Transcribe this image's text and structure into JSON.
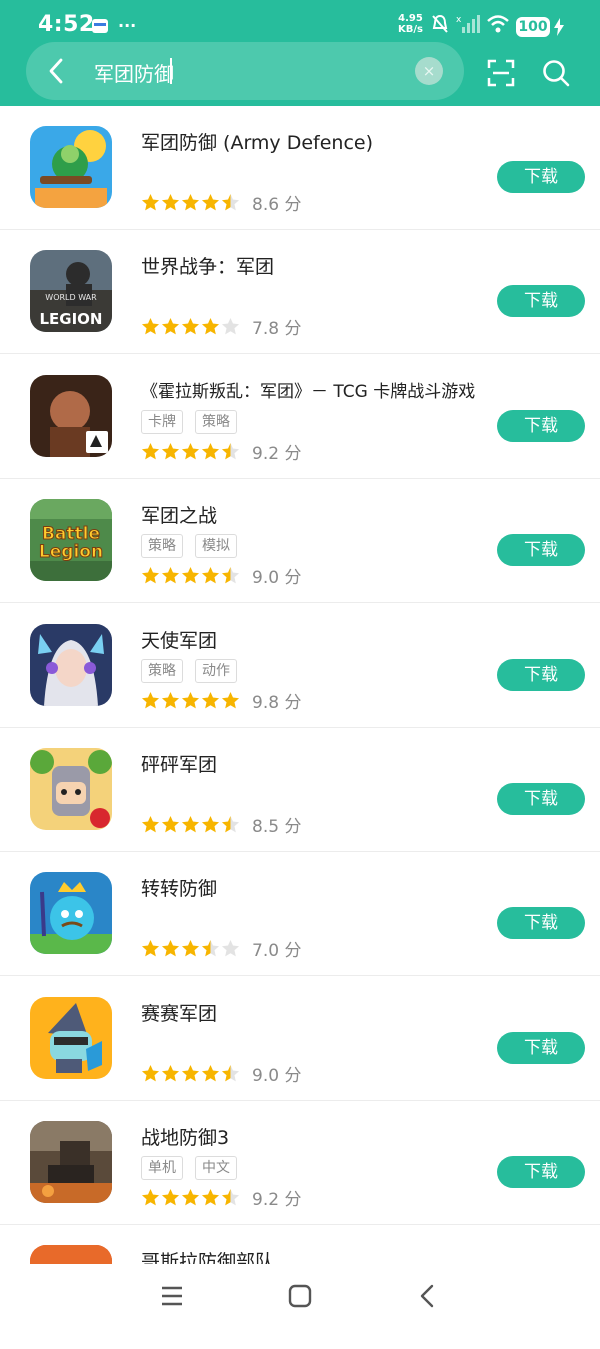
{
  "status_bar": {
    "time": "4:52",
    "net_speed_value": "4.95",
    "net_speed_unit": "KB/s",
    "battery": "100"
  },
  "search": {
    "query": "军团防御",
    "clear_glyph": "×",
    "back_icon": "back-arrow-icon",
    "scan_icon": "scan-icon",
    "search_icon": "search-icon"
  },
  "colors": {
    "accent": "#27bd9c",
    "star": "#f7b500",
    "star_empty": "#e3e3e3"
  },
  "download_label": "下载",
  "apps": [
    {
      "name": "军团防御 (Army Defence)",
      "tags": [],
      "rating": 4.5,
      "score": "8.6 分"
    },
    {
      "name": "世界战争：军团",
      "tags": [],
      "rating": 4,
      "score": "7.8 分",
      "icon_text_1": "WORLD WAR",
      "icon_text_2": "LEGION"
    },
    {
      "name": "《霍拉斯叛乱：军团》－ TCG 卡牌战斗游戏",
      "tags": [
        "卡牌",
        "策略"
      ],
      "rating": 4.5,
      "score": "9.2 分"
    },
    {
      "name": "军团之战",
      "tags": [
        "策略",
        "模拟"
      ],
      "rating": 4.5,
      "score": "9.0 分",
      "icon_text_1": "Battle",
      "icon_text_2": "Legion"
    },
    {
      "name": "天使军团",
      "tags": [
        "策略",
        "动作"
      ],
      "rating": 5,
      "score": "9.8 分"
    },
    {
      "name": "砰砰军团",
      "tags": [],
      "rating": 4.5,
      "score": "8.5 分"
    },
    {
      "name": "转转防御",
      "tags": [],
      "rating": 3.5,
      "score": "7.0 分"
    },
    {
      "name": "赛赛军团",
      "tags": [],
      "rating": 4.5,
      "score": "9.0 分"
    },
    {
      "name": "战地防御3",
      "tags": [
        "单机",
        "中文"
      ],
      "rating": 4.5,
      "score": "9.2 分"
    },
    {
      "name": "哥斯拉防御部队",
      "tags": [],
      "rating": 0,
      "score": ""
    }
  ],
  "nav": {
    "menu_icon": "menu-icon",
    "home_icon": "home-icon",
    "back_icon": "nav-back-icon"
  }
}
